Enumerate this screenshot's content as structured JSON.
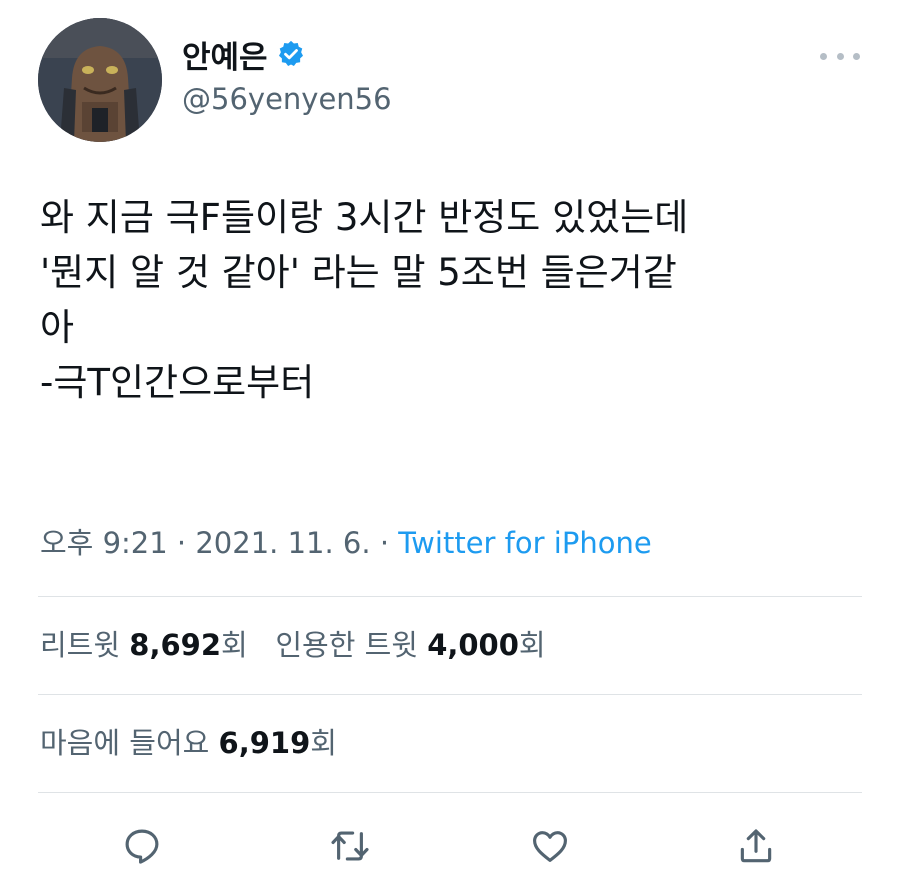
{
  "user": {
    "display_name": "안예은",
    "handle": "@56yenyen56",
    "verified": true
  },
  "tweet": {
    "lines": [
      "와 지금 극F들이랑 3시간 반정도 있었는데",
      "'뭔지 알 것 같아' 라는 말 5조번 들은거같",
      "아",
      "-극T인간으로부터"
    ]
  },
  "meta": {
    "time": "오후 9:21",
    "date": "2021. 11. 6.",
    "separator": " · ",
    "source": "Twitter for iPhone"
  },
  "stats": {
    "retweets_label": "리트윗",
    "retweets_count": "8,692",
    "retweets_suffix": "회",
    "quotes_label": "인용한 트윗",
    "quotes_count": "4,000",
    "quotes_suffix": "회",
    "likes_label": "마음에 들어요",
    "likes_count": "6,919",
    "likes_suffix": "회"
  },
  "actions": {
    "reply_icon": "speech-bubble",
    "retweet_icon": "retweet-arrows",
    "like_icon": "heart",
    "share_icon": "share-upload"
  },
  "colors": {
    "accent": "#1d9bf0",
    "secondary_text": "#536471",
    "primary_text": "#0f1419",
    "divider": "#dfe3e6"
  }
}
